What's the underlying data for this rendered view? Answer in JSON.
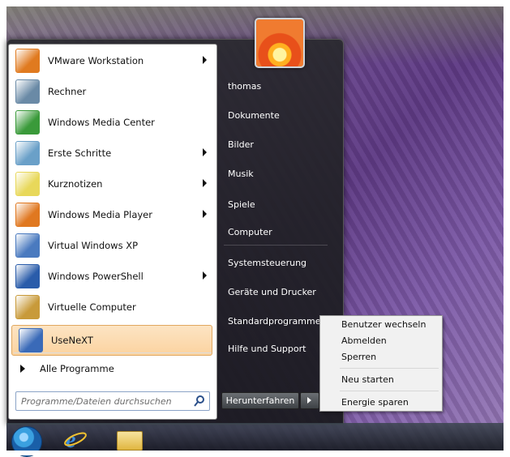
{
  "programs": [
    {
      "label": "VMware Workstation",
      "icon": "vmware-icon",
      "has_arrow": true,
      "color": "#e07a1f"
    },
    {
      "label": "Rechner",
      "icon": "calculator-icon",
      "has_arrow": false,
      "color": "#6a8aa6"
    },
    {
      "label": "Windows Media Center",
      "icon": "media-center-icon",
      "has_arrow": false,
      "color": "#3a9a3a"
    },
    {
      "label": "Erste Schritte",
      "icon": "getting-started-icon",
      "has_arrow": true,
      "color": "#6aa0c8"
    },
    {
      "label": "Kurznotizen",
      "icon": "sticky-notes-icon",
      "has_arrow": true,
      "color": "#e8d85a"
    },
    {
      "label": "Windows Media Player",
      "icon": "media-player-icon",
      "has_arrow": true,
      "color": "#e07820"
    },
    {
      "label": "Virtual Windows XP",
      "icon": "virtual-xp-icon",
      "has_arrow": false,
      "color": "#4a7abf"
    },
    {
      "label": "Windows PowerShell",
      "icon": "powershell-icon",
      "has_arrow": true,
      "color": "#2a5caa"
    },
    {
      "label": "Virtuelle Computer",
      "icon": "virtual-pc-icon",
      "has_arrow": false,
      "color": "#c89a3a"
    },
    {
      "label": "UseNeXT",
      "icon": "usenext-icon",
      "has_arrow": false,
      "color": "#3a6ab8"
    }
  ],
  "all_programs": "Alle Programme",
  "search": {
    "placeholder": "Programme/Dateien durchsuchen"
  },
  "right_items": [
    "thomas",
    "Dokumente",
    "Bilder",
    "Musik",
    "Spiele",
    "Computer",
    "Systemsteuerung",
    "Geräte und Drucker",
    "Standardprogramme",
    "Hilfe und Support"
  ],
  "shutdown_label": "Herunterfahren",
  "shutdown_submenu": [
    "Benutzer wechseln",
    "Abmelden",
    "Sperren",
    "Neu starten",
    "Energie sparen"
  ],
  "taskbar_icons": [
    "start-orb-icon",
    "internet-explorer-icon",
    "explorer-folder-icon"
  ]
}
